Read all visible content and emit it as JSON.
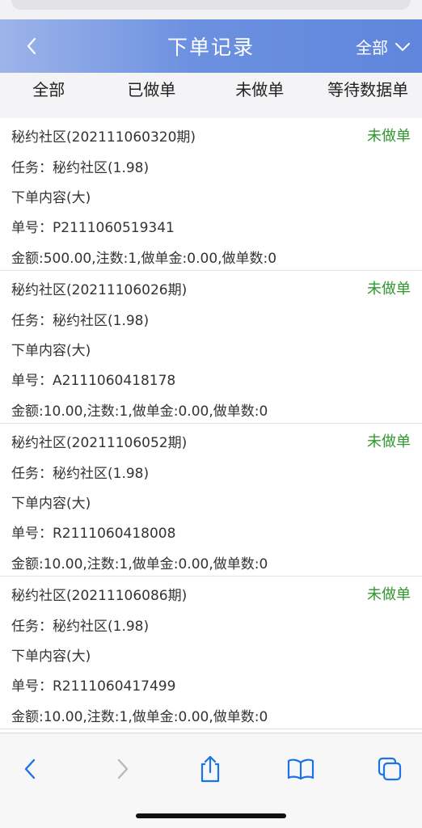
{
  "header": {
    "title": "下单记录",
    "filter_label": "全部"
  },
  "tabs": [
    {
      "label": "全部"
    },
    {
      "label": "已做单"
    },
    {
      "label": "未做单"
    },
    {
      "label": "等待数据单"
    }
  ],
  "records": [
    {
      "name": "秘约社区(202111060320期)",
      "status": "未做单",
      "task": "任务：秘约社区(1.98)",
      "content": "下单内容(大)",
      "order_no": "单号：P2111060519341",
      "summary": "金额:500.00,注数:1,做单金:0.00,做单数:0"
    },
    {
      "name": "秘约社区(20211106026期)",
      "status": "未做单",
      "task": "任务：秘约社区(1.98)",
      "content": "下单内容(大)",
      "order_no": "单号：A2111060418178",
      "summary": "金额:10.00,注数:1,做单金:0.00,做单数:0"
    },
    {
      "name": "秘约社区(20211106052期)",
      "status": "未做单",
      "task": "任务：秘约社区(1.98)",
      "content": "下单内容(大)",
      "order_no": "单号：R2111060418008",
      "summary": "金额:10.00,注数:1,做单金:0.00,做单数:0"
    },
    {
      "name": "秘约社区(20211106086期)",
      "status": "未做单",
      "task": "任务：秘约社区(1.98)",
      "content": "下单内容(大)",
      "order_no": "单号：R2111060417499",
      "summary": "金额:10.00,注数:1,做单金:0.00,做单数:0"
    }
  ],
  "toolbar": {
    "icons": [
      "back-icon",
      "forward-icon",
      "share-icon",
      "bookmarks-icon",
      "tabs-icon"
    ],
    "accent": "#1a73e8"
  },
  "colors": {
    "header_gradient_start": "#9db4ea",
    "header_gradient_end": "#5f86dc",
    "status_green": "#2e9a2e"
  }
}
